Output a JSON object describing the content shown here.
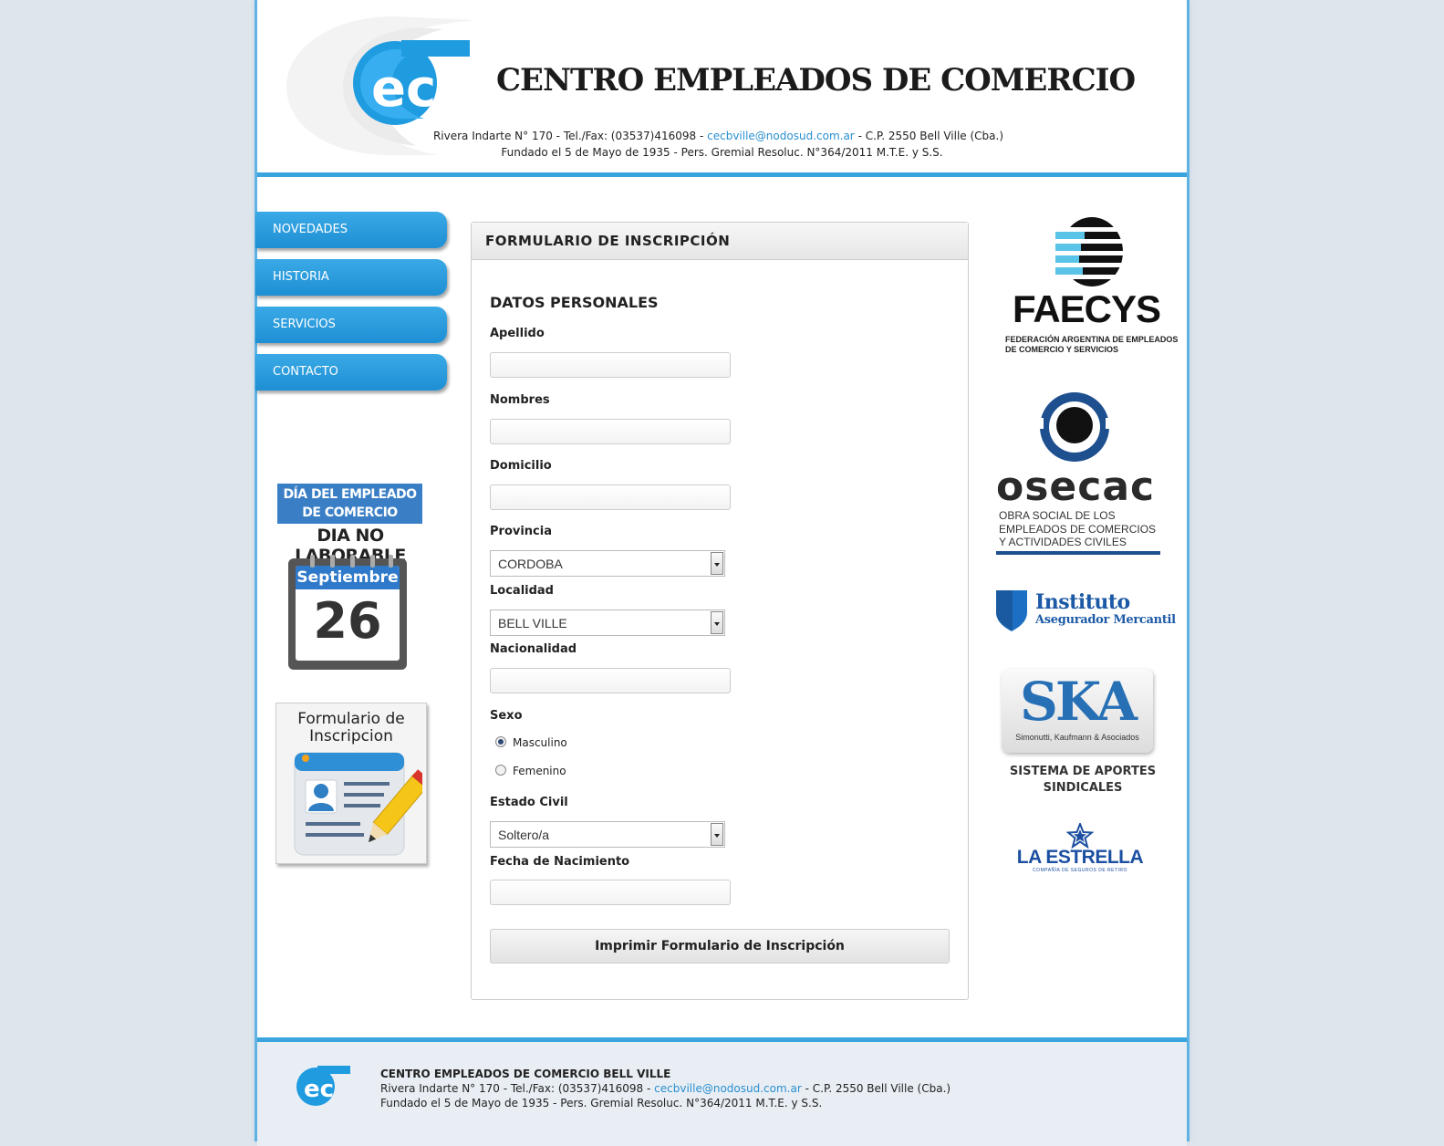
{
  "header": {
    "title": "CENTRO EMPLEADOS DE COMERCIO",
    "address_pre": "Rivera Indarte N° 170 - Tel./Fax: (03537)416098 -",
    "email": "cecbville@nodosud.com.ar",
    "address_post": "- C.P. 2550 Bell Ville (Cba.)",
    "founded": "Fundado el 5 de Mayo de 1935 - Pers. Gremial Resoluc. N°364/2011 M.T.E. y S.S."
  },
  "nav": {
    "items": [
      {
        "label": "NOVEDADES"
      },
      {
        "label": "HISTORIA"
      },
      {
        "label": "SERVICIOS"
      },
      {
        "label": "CONTACTO"
      }
    ]
  },
  "sidebar": {
    "dia_line1": "DÍA DEL EMPLEADO",
    "dia_line2": "DE COMERCIO",
    "dia_sub": "DIA NO LABORABLE",
    "cal_month": "Septiembre",
    "cal_day": "26",
    "form_banner_line1": "Formulario de",
    "form_banner_line2": "Inscripcion"
  },
  "form": {
    "panel_title": "FORMULARIO DE INSCRIPCIÓN",
    "section_title": "DATOS PERSONALES",
    "apellido_label": "Apellido",
    "apellido_value": "",
    "nombres_label": "Nombres",
    "nombres_value": "",
    "domicilio_label": "Domicilio",
    "domicilio_value": "",
    "provincia_label": "Provincia",
    "provincia_value": "CORDOBA",
    "localidad_label": "Localidad",
    "localidad_value": "BELL VILLE",
    "nacionalidad_label": "Nacionalidad",
    "nacionalidad_value": "",
    "sexo_label": "Sexo",
    "sexo_options": [
      "Masculino",
      "Femenino"
    ],
    "sexo_selected": "Masculino",
    "estado_civil_label": "Estado Civil",
    "estado_civil_value": "Soltero/a",
    "fecha_label": "Fecha de Nacimiento",
    "fecha_value": "",
    "print_button": "Imprimir Formulario de Inscripción"
  },
  "sponsors": {
    "faecys_name": "FAECYS",
    "faecys_sub1": "FEDERACIÓN ARGENTINA DE EMPLEADOS",
    "faecys_sub2": "DE COMERCIO Y SERVICIOS",
    "osecac_name": "osecac",
    "osecac_sub1": "OBRA SOCIAL DE LOS",
    "osecac_sub2": "EMPLEADOS DE COMERCIOS",
    "osecac_sub3": "Y ACTIVIDADES CIVILES",
    "iam_line1": "Instituto",
    "iam_line2": "Asegurador Mercantil",
    "ska_logo": "SKA",
    "ska_sub": "Simonutti, Kaufmann & Asociados",
    "ska_caption1": "SISTEMA DE APORTES",
    "ska_caption2": "SINDICALES",
    "estrella_name": "LA ESTRELLA",
    "estrella_sub": "COMPAÑÍA DE SEGUROS DE RETIRO"
  },
  "footer": {
    "title": "CENTRO EMPLEADOS DE COMERCIO BELL VILLE",
    "address_pre": "Rivera Indarte N° 170 - Tel./Fax: (03537)416098 -",
    "email": "cecbville@nodosud.com.ar",
    "address_post": "- C.P. 2550 Bell Ville (Cba.)",
    "founded": "Fundado el 5 de Mayo de 1935 - Pers. Gremial Resoluc. N°364/2011 M.T.E. y S.S."
  },
  "colors": {
    "accent": "#3aa4df",
    "nav_bg": "#2496dc",
    "link": "#2a8fd1",
    "page_bg": "#dfe5ec"
  }
}
